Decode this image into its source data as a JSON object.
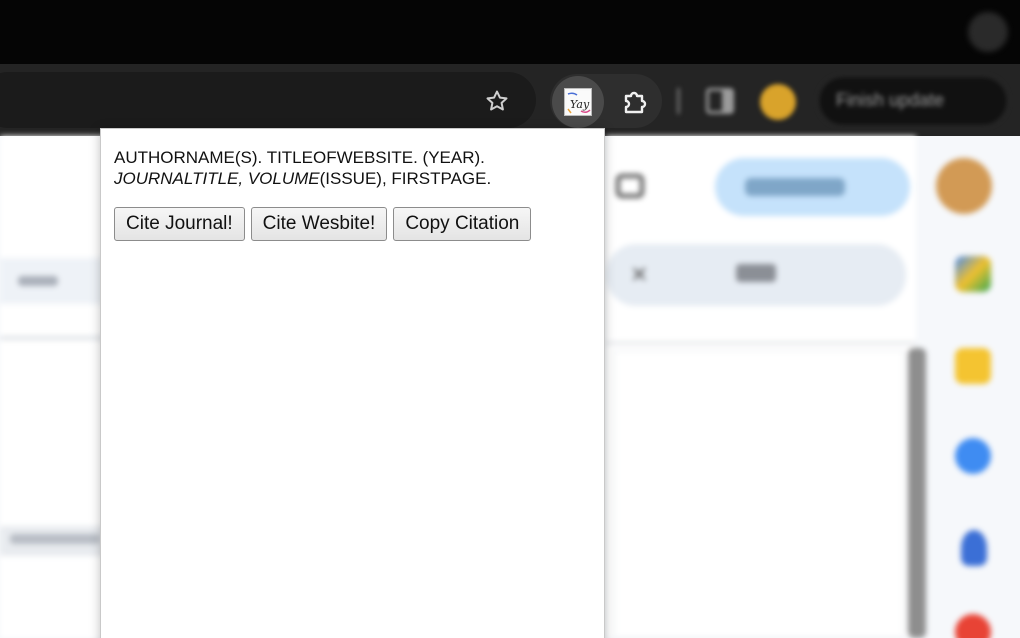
{
  "browser": {
    "finish_update_label": "Finish update",
    "extension_logo_text": "Yay"
  },
  "popup": {
    "citation_line1": "AUTHORNAME(S). TITLEOFWEBSITE. (YEAR).",
    "citation_journal": "JOURNALTITLE",
    "citation_comma": ", ",
    "citation_volume": "VOLUME",
    "citation_rest": "(ISSUE), FIRSTPAGE.",
    "buttons": {
      "cite_journal": "Cite Journal!",
      "cite_website": "Cite Wesbite!",
      "copy_citation": "Copy Citation"
    }
  },
  "colors": {
    "titlebar": "#050505",
    "toolbar": "#242424",
    "popup_bg": "#ffffff",
    "meet_button": "#c5e2fb",
    "profile": "#d9a32b"
  },
  "icons": [
    "star-icon",
    "yay-extension-icon",
    "puzzle-icon",
    "side-panel-icon",
    "profile-avatar",
    "camera-icon",
    "pen-icon"
  ]
}
